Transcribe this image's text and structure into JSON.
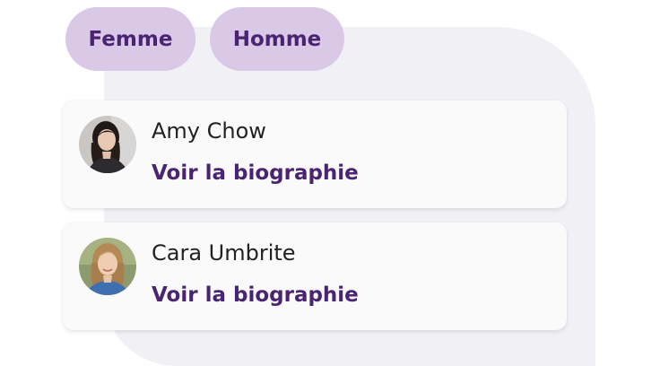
{
  "filters": {
    "femme_label": "Femme",
    "homme_label": "Homme"
  },
  "people": [
    {
      "name": "Amy Chow",
      "link_label": "Voir la biographie"
    },
    {
      "name": "Cara Umbrite",
      "link_label": "Voir la biographie"
    }
  ],
  "colors": {
    "accent": "#4a2473",
    "chip_background": "#d9c8e6",
    "card_background": "#fafafa",
    "backdrop": "#f1f1f5"
  }
}
